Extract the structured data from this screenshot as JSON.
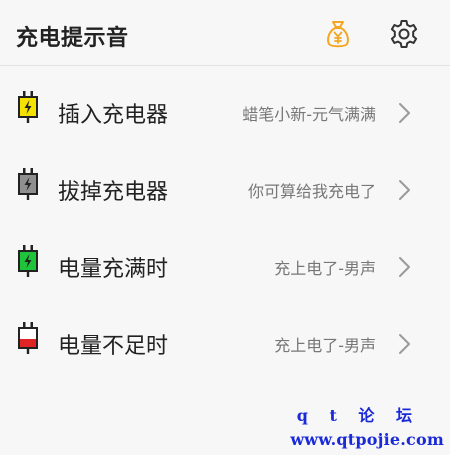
{
  "header": {
    "title": "充电提示音",
    "icons": {
      "money_bag": "money-bag-icon",
      "settings": "gear-icon"
    }
  },
  "rows": [
    {
      "label": "插入充电器",
      "value": "蜡笔小新-元气满满",
      "icon": "plug-in-icon",
      "accent": "#f5e100"
    },
    {
      "label": "拔掉充电器",
      "value": "你可算给我充电了",
      "icon": "unplug-icon",
      "accent": "#8f8f8f"
    },
    {
      "label": "电量充满时",
      "value": "充上电了-男声",
      "icon": "battery-full-icon",
      "accent": "#1fc43a"
    },
    {
      "label": "电量不足时",
      "value": "充上电了-男声",
      "icon": "battery-low-icon",
      "accent": "#e02424"
    }
  ],
  "watermark": {
    "line1": "q t 论 坛",
    "line2": "www.qtpojie.com"
  },
  "colors": {
    "background": "#f7f7f7",
    "money_icon": "#f5a623",
    "watermark": "#1a2ad8"
  }
}
